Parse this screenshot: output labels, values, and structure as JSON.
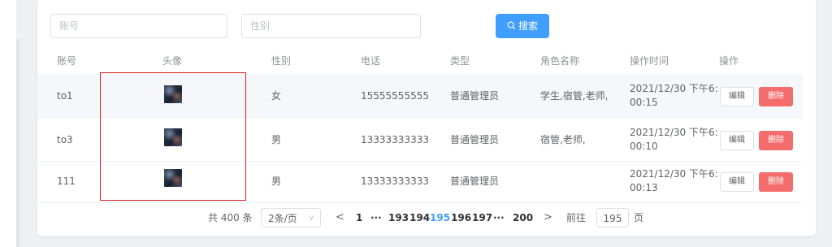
{
  "filters": {
    "account_placeholder": "账号",
    "gender_placeholder": "性别",
    "search_label": "搜索"
  },
  "table": {
    "headers": [
      "账号",
      "头像",
      "性别",
      "电话",
      "类型",
      "角色名称",
      "操作时间",
      "操作"
    ],
    "rows": [
      {
        "account": "to1",
        "gender": "女",
        "phone": "15555555555",
        "type": "普通管理员",
        "roles": "学生,宿管,老师,",
        "time": "2021/12/30 下午6:\n00:15"
      },
      {
        "account": "to3",
        "gender": "男",
        "phone": "13333333333",
        "type": "普通管理员",
        "roles": "宿管,老师,",
        "time": "2021/12/30 下午6:\n00:10"
      },
      {
        "account": "111",
        "gender": "男",
        "phone": "13333333333",
        "type": "普通管理员",
        "roles": "",
        "time": "2021/12/30 下午6:\n00:13"
      }
    ],
    "edit_label": "编辑",
    "delete_label": "删除"
  },
  "pagination": {
    "total_text": "共 400 条",
    "page_size": "2条/页",
    "prev": "<",
    "next": ">",
    "pages": [
      "1",
      "···",
      "193",
      "194",
      "195",
      "196",
      "197",
      "···",
      "200"
    ],
    "current_page": "195",
    "goto_prefix": "前往",
    "goto_value": "195",
    "goto_suffix": "页"
  },
  "colors": {
    "primary": "#409eff",
    "danger": "#f56c6c",
    "highlight_box": "#e02020"
  }
}
